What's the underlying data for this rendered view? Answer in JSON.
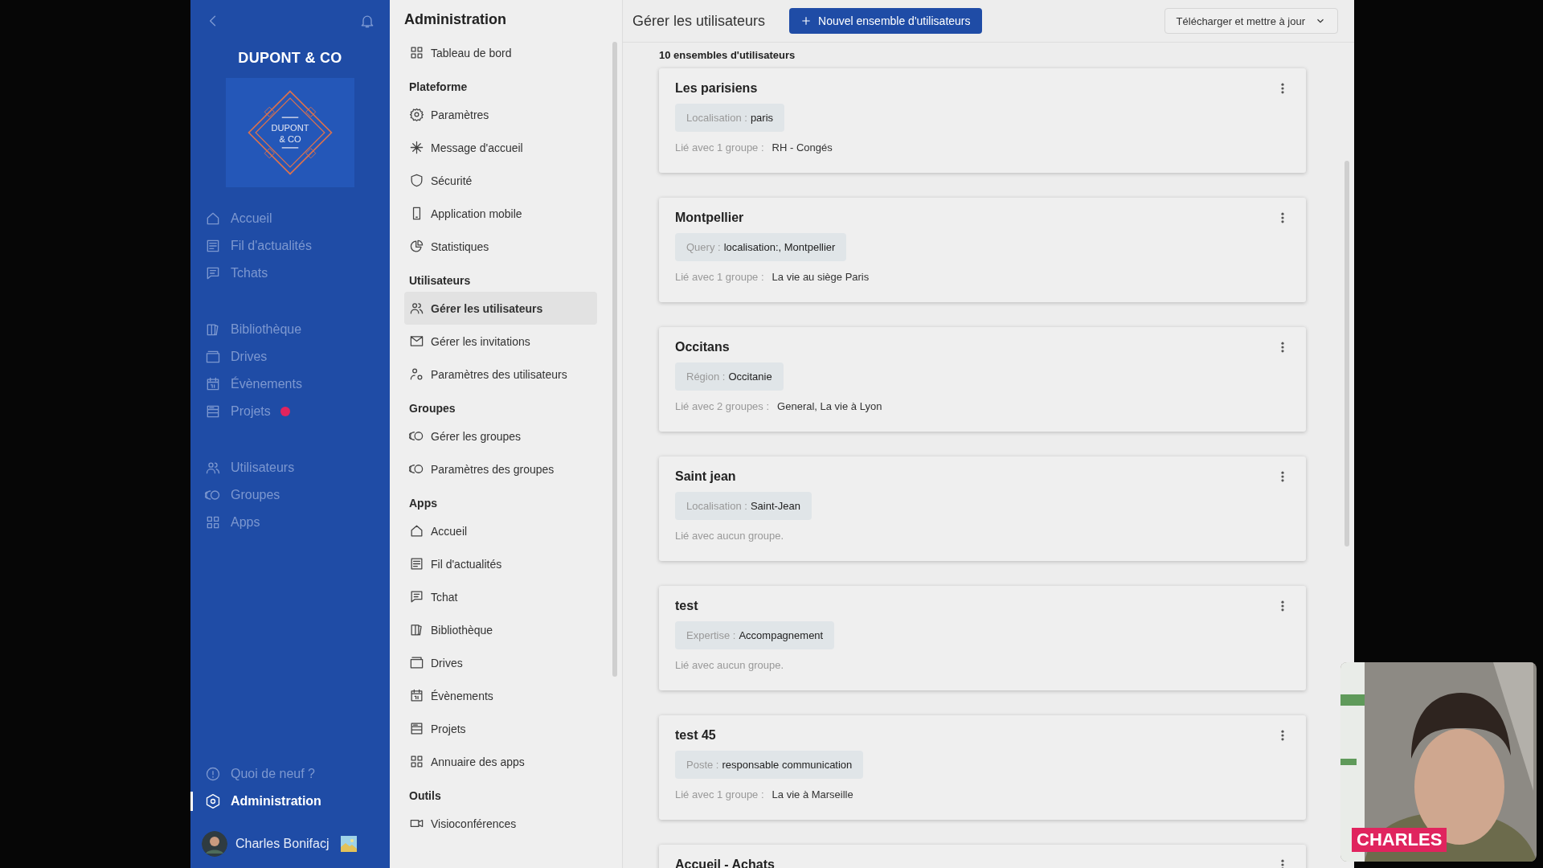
{
  "sidebar": {
    "brand": "DUPONT & CO",
    "logo_lines": [
      "DUPONT",
      "& CO"
    ],
    "nav_groups": [
      {
        "items": [
          {
            "label": "Accueil",
            "notification": false
          },
          {
            "label": "Fil d'actualités",
            "notification": false
          },
          {
            "label": "Tchats",
            "notification": false
          }
        ]
      },
      {
        "items": [
          {
            "label": "Bibliothèque",
            "notification": false
          },
          {
            "label": "Drives",
            "notification": false
          },
          {
            "label": "Évènements",
            "notification": false
          },
          {
            "label": "Projets",
            "notification": true
          }
        ]
      },
      {
        "items": [
          {
            "label": "Utilisateurs",
            "notification": false
          },
          {
            "label": "Groupes",
            "notification": false
          },
          {
            "label": "Apps",
            "notification": false
          }
        ]
      }
    ],
    "footer_items": [
      {
        "label": "Quoi de neuf ?",
        "selected": false
      },
      {
        "label": "Administration",
        "selected": true
      }
    ],
    "user": {
      "name": "Charles Bonifacj"
    }
  },
  "admin_nav": {
    "title": "Administration",
    "sections": [
      {
        "items": [
          {
            "label": "Tableau de bord",
            "selected": false
          }
        ]
      },
      {
        "heading": "Plateforme",
        "items": [
          {
            "label": "Paramètres",
            "selected": false
          },
          {
            "label": "Message d'accueil",
            "selected": false
          },
          {
            "label": "Sécurité",
            "selected": false
          },
          {
            "label": "Application mobile",
            "selected": false
          },
          {
            "label": "Statistiques",
            "selected": false
          }
        ]
      },
      {
        "heading": "Utilisateurs",
        "items": [
          {
            "label": "Gérer les utilisateurs",
            "selected": true
          },
          {
            "label": "Gérer les invitations",
            "selected": false
          },
          {
            "label": "Paramètres des utilisateurs",
            "selected": false
          }
        ]
      },
      {
        "heading": "Groupes",
        "items": [
          {
            "label": "Gérer les groupes",
            "selected": false
          },
          {
            "label": "Paramètres des groupes",
            "selected": false
          }
        ]
      },
      {
        "heading": "Apps",
        "items": [
          {
            "label": "Accueil",
            "selected": false
          },
          {
            "label": "Fil d'actualités",
            "selected": false
          },
          {
            "label": "Tchat",
            "selected": false
          },
          {
            "label": "Bibliothèque",
            "selected": false
          },
          {
            "label": "Drives",
            "selected": false
          },
          {
            "label": "Évènements",
            "selected": false
          },
          {
            "label": "Projets",
            "selected": false
          },
          {
            "label": "Annuaire des apps",
            "selected": false
          }
        ]
      },
      {
        "heading": "Outils",
        "items": [
          {
            "label": "Visioconférences",
            "selected": false
          }
        ]
      }
    ]
  },
  "main": {
    "title": "Gérer les utilisateurs",
    "new_button": "Nouvel ensemble d'utilisateurs",
    "download_button": "Télécharger et mettre à jour",
    "count": "10 ensembles d'utilisateurs",
    "user_sets": [
      {
        "title": "Les parisiens",
        "criterion": {
          "label": "Localisation :",
          "value": "paris"
        },
        "link_label": "Lié avec 1 groupe :",
        "link_value": "RH - Congés"
      },
      {
        "title": "Montpellier",
        "criterion": {
          "label": "Query :",
          "value": "localisation:, Montpellier"
        },
        "link_label": "Lié avec 1 groupe :",
        "link_value": "La vie au siège Paris"
      },
      {
        "title": "Occitans",
        "criterion": {
          "label": "Région :",
          "value": "Occitanie"
        },
        "link_label": "Lié avec 2 groupes :",
        "link_value": "General, La vie à Lyon"
      },
      {
        "title": "Saint jean",
        "criterion": {
          "label": "Localisation :",
          "value": "Saint-Jean"
        },
        "link_label": "Lié avec aucun groupe."
      },
      {
        "title": "test",
        "criterion": {
          "label": "Expertise :",
          "value": "Accompagnement"
        },
        "link_label": "Lié avec aucun groupe."
      },
      {
        "title": "test 45",
        "criterion": {
          "label": "Poste :",
          "value": "responsable communication"
        },
        "link_label": "Lié avec 1 groupe :",
        "link_value": "La vie à Marseille"
      },
      {
        "title": "Accueil - Achats"
      }
    ]
  },
  "webcam": {
    "kind": "picture",
    "name_tag": "CHARLES"
  }
}
